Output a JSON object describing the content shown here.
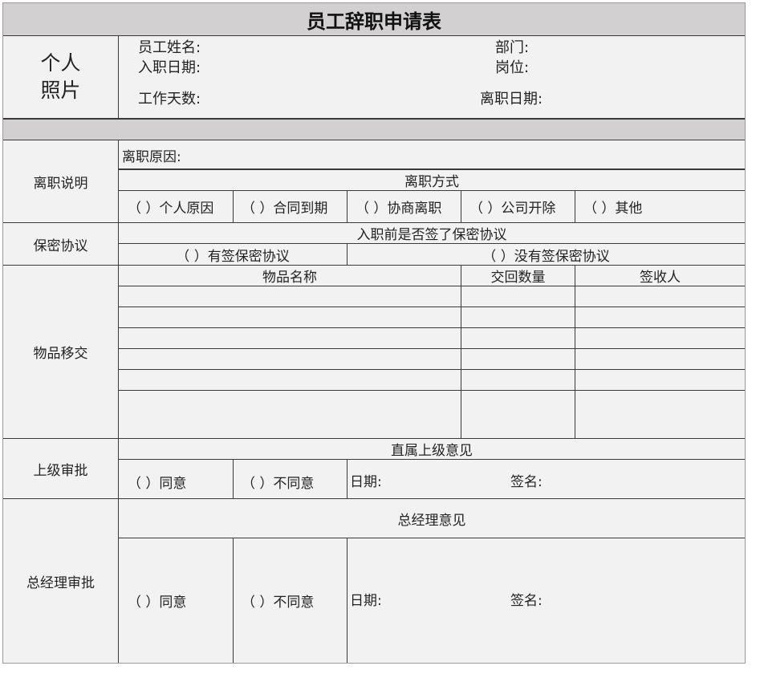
{
  "title": "员工辞职申请表",
  "photo": {
    "line1": "个人",
    "line2": "照片"
  },
  "info": {
    "name": "员工姓名:",
    "dept": "部门:",
    "hire_date": "入职日期:",
    "position": "岗位:",
    "work_days": "工作天数:",
    "leave_date": "离职日期:"
  },
  "resign": {
    "label": "离职说明",
    "reason": "离职原因:",
    "method_header": "离职方式",
    "options": [
      "（  ）个人原因",
      "（  ）合同到期",
      "（  ）协商离职",
      "（  ）公司开除",
      "（  ）其他"
    ]
  },
  "confidential": {
    "label": "保密协议",
    "question": "入职前是否签了保密协议",
    "signed": "（  ）有签保密协议",
    "not_signed": "（  ）没有签保密协议"
  },
  "handover": {
    "label": "物品移交",
    "columns": [
      "物品名称",
      "交回数量",
      "签收人"
    ]
  },
  "supervisor": {
    "label": "上级审批",
    "header": "直属上级意见",
    "agree": "（  ）同意",
    "disagree": "（  ）不同意",
    "date": "日期:",
    "sign": "签名:"
  },
  "gm": {
    "label": "总经理审批",
    "header": "总经理意见",
    "agree": "（  ）同意",
    "disagree": "（  ）不同意",
    "date": "日期:",
    "sign": "签名:"
  }
}
